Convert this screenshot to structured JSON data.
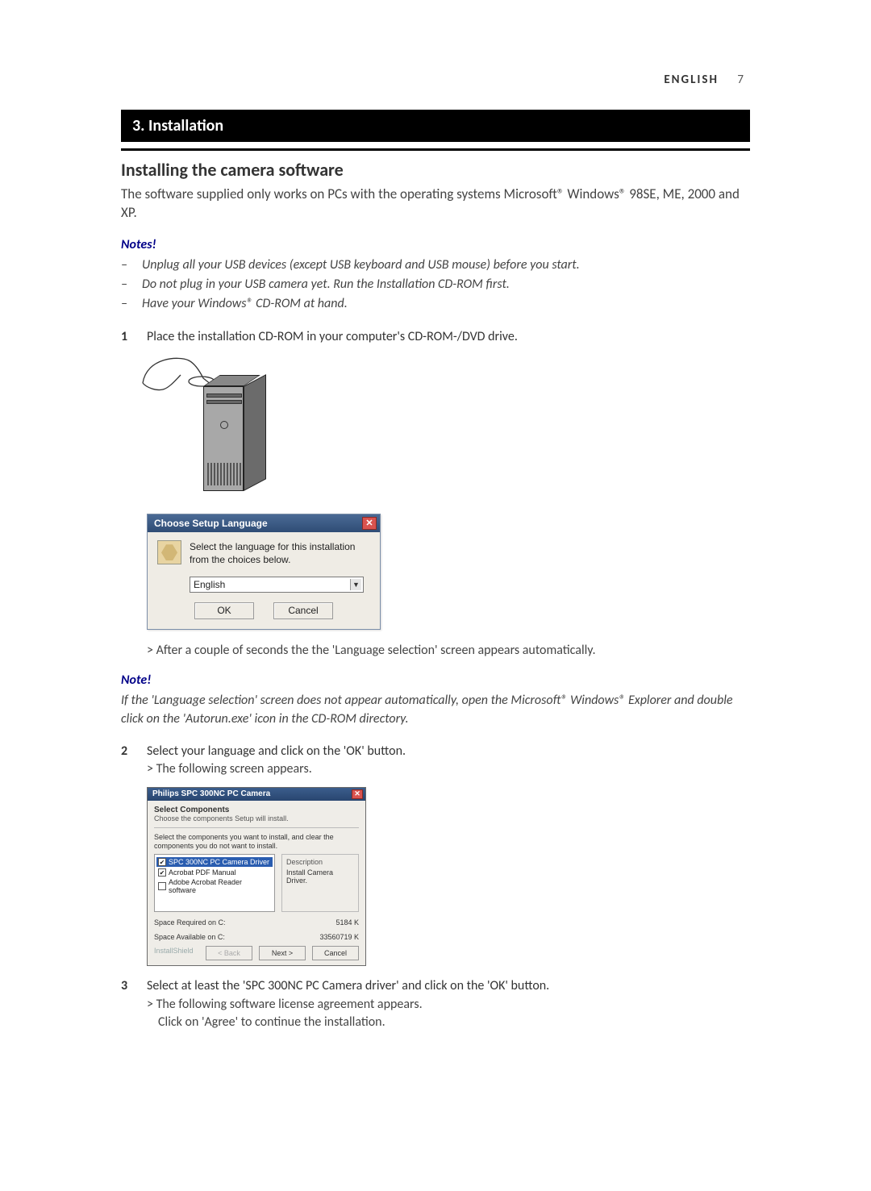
{
  "header": {
    "language": "ENGLISH",
    "page_number": "7"
  },
  "section": {
    "number_title": "3. Installation",
    "subheading": "Installing the camera software"
  },
  "intro": "The software supplied only works on PCs with the operating systems Microsoft® Windows® 98SE, ME, 2000 and XP.",
  "notes_group": {
    "heading": "Notes!",
    "items": [
      "Unplug all your USB devices (except USB keyboard and USB mouse) before you start.",
      "Do not plug in your USB camera yet. Run the Installation CD-ROM first.",
      "Have your Windows® CD-ROM at hand."
    ]
  },
  "step1": {
    "num": "1",
    "text": "Place the installation CD-ROM in your computer's CD-ROM-/DVD drive.",
    "result": "> After a couple of seconds the the 'Language selection' screen appears automatically."
  },
  "lang_dialog": {
    "title": "Choose Setup Language",
    "close": "✕",
    "message": "Select the language for this installation from the choices below.",
    "selected": "English",
    "ok": "OK",
    "cancel": "Cancel"
  },
  "note_single": {
    "heading": "Note!",
    "text": "If the 'Language selection' screen does not appear automatically, open the Microsoft® Windows® Explorer and double click on the 'Autorun.exe' icon in the CD-ROM directory."
  },
  "step2": {
    "num": "2",
    "text": "Select your language and click on the 'OK' button.",
    "result": "> The following screen appears."
  },
  "components_dialog": {
    "title": "Philips SPC 300NC PC Camera",
    "close": "✕",
    "subtitle": "Select Components",
    "subtitle2": "Choose the components Setup will install.",
    "instruction": "Select the components you want to install, and clear the components you do not want to install.",
    "items": [
      {
        "label": "SPC 300NC PC Camera Driver",
        "checked": true,
        "selected": true
      },
      {
        "label": "Acrobat PDF Manual",
        "checked": true,
        "selected": false
      },
      {
        "label": "Adobe Acrobat Reader software",
        "checked": false,
        "selected": false
      }
    ],
    "description_label": "Description",
    "description_text": "Install Camera Driver.",
    "space_required_label": "Space Required on C:",
    "space_required_value": "5184 K",
    "space_available_label": "Space Available on C:",
    "space_available_value": "33560719 K",
    "install_prefix": "InstallShield",
    "back": "< Back",
    "next": "Next >",
    "cancel": "Cancel"
  },
  "step3": {
    "num": "3",
    "text": "Select at least the 'SPC 300NC PC Camera driver' and click on the 'OK' button.",
    "result1": "> The following software license agreement appears.",
    "result2": "Click on 'Agree' to continue the installation."
  }
}
